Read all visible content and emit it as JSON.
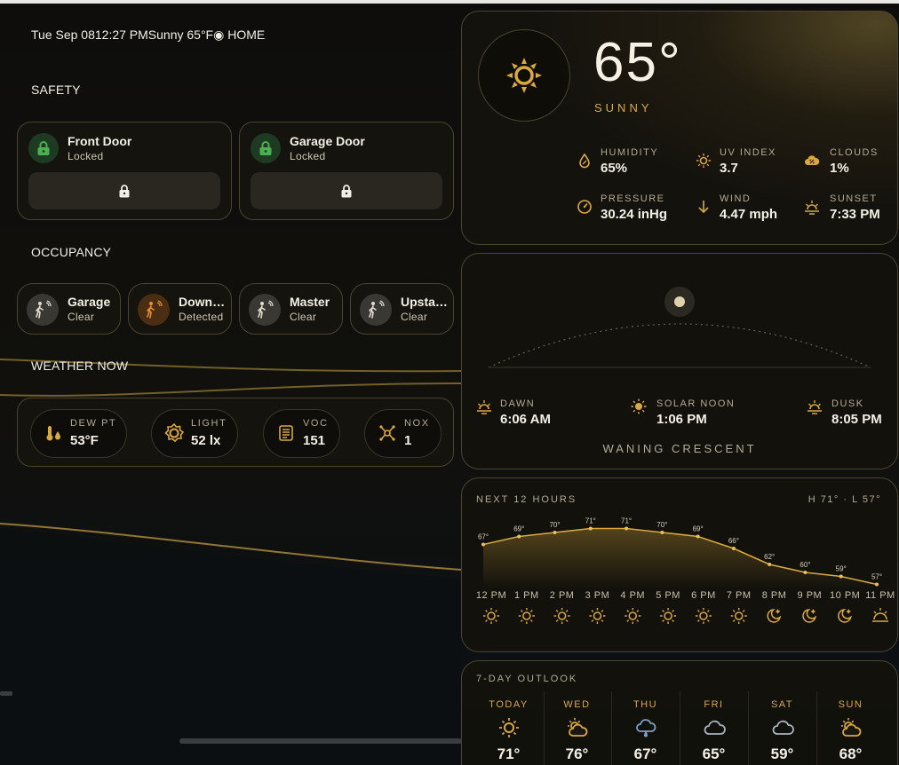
{
  "status_bar": {
    "text": "Tue Sep 0812:27 PMSunny 65°F◉ HOME"
  },
  "safety": {
    "title": "SAFETY",
    "locks": [
      {
        "name": "Front Door",
        "state": "Locked"
      },
      {
        "name": "Garage Door",
        "state": "Locked"
      }
    ]
  },
  "occupancy": {
    "title": "OCCUPANCY",
    "sensors": [
      {
        "name": "Garage",
        "state": "Clear",
        "active": false
      },
      {
        "name": "Downstairs",
        "state": "Detected",
        "active": true
      },
      {
        "name": "Master",
        "state": "Clear",
        "active": false
      },
      {
        "name": "Upstairs",
        "state": "Clear",
        "active": false
      }
    ]
  },
  "weather_now": {
    "title": "WEATHER NOW",
    "items": [
      {
        "label": "DEW PT",
        "value": "53°F",
        "icon": "thermometer-drop-icon"
      },
      {
        "label": "LIGHT",
        "value": "52 lx",
        "icon": "brightness-icon"
      },
      {
        "label": "VOC",
        "value": "151",
        "icon": "air-filter-icon"
      },
      {
        "label": "NOX",
        "value": "1",
        "icon": "molecule-icon"
      }
    ]
  },
  "current": {
    "temp": "65°",
    "condition": "SUNNY",
    "stats": [
      {
        "label": "HUMIDITY",
        "value": "65%",
        "icon": "humidity-drop-icon"
      },
      {
        "label": "UV INDEX",
        "value": "3.7",
        "icon": "uv-sun-icon"
      },
      {
        "label": "CLOUDS",
        "value": "1%",
        "icon": "cloud-percent-icon"
      },
      {
        "label": "PRESSURE",
        "value": "30.24 inHg",
        "icon": "gauge-icon"
      },
      {
        "label": "WIND",
        "value": "4.47 mph",
        "icon": "wind-arrow-icon"
      },
      {
        "label": "SUNSET",
        "value": "7:33 PM",
        "icon": "sunset-icon"
      }
    ]
  },
  "sun_path": {
    "dawn_label": "DAWN",
    "dawn": "6:06 AM",
    "noon_label": "SOLAR NOON",
    "noon": "1:06 PM",
    "dusk_label": "DUSK",
    "dusk": "8:05 PM",
    "moon_phase": "WANING CRESCENT"
  },
  "hourly": {
    "title": "NEXT 12 HOURS",
    "hi_lo": "H 71° · L 57°",
    "hours": [
      "12 PM",
      "1 PM",
      "2 PM",
      "3 PM",
      "4 PM",
      "5 PM",
      "6 PM",
      "7 PM",
      "8 PM",
      "9 PM",
      "10 PM",
      "11 PM"
    ],
    "temps": [
      67,
      69,
      70,
      71,
      71,
      70,
      69,
      66,
      62,
      60,
      59,
      57
    ],
    "temp_labels": [
      "67°",
      "69°",
      "70°",
      "71°",
      "71°",
      "70°",
      "69°",
      "66°",
      "62°",
      "60°",
      "59°",
      "57°"
    ],
    "icons": [
      "sun-icon",
      "sun-icon",
      "sun-icon",
      "sun-icon",
      "sun-icon",
      "sun-icon",
      "sun-icon",
      "sun-icon",
      "moon-star-icon",
      "moon-star-icon",
      "moon-star-icon",
      "sunrise-cloud-icon"
    ]
  },
  "outlook": {
    "title": "7-DAY OUTLOOK",
    "days": [
      {
        "name": "TODAY",
        "hi": "71°",
        "icon": "sun-icon"
      },
      {
        "name": "WED",
        "hi": "76°",
        "icon": "partly-sunny-icon"
      },
      {
        "name": "THU",
        "hi": "67°",
        "icon": "rain-cloud-icon"
      },
      {
        "name": "FRI",
        "hi": "65°",
        "icon": "cloud-icon"
      },
      {
        "name": "SAT",
        "hi": "59°",
        "icon": "cloud-icon"
      },
      {
        "name": "SUN",
        "hi": "68°",
        "icon": "partly-sunny-icon"
      }
    ]
  },
  "colors": {
    "accent": "#d9a93c",
    "lock_green": "#4caf50",
    "occupancy_active": "#e8902a",
    "low_temp": "#7f9fc4"
  }
}
